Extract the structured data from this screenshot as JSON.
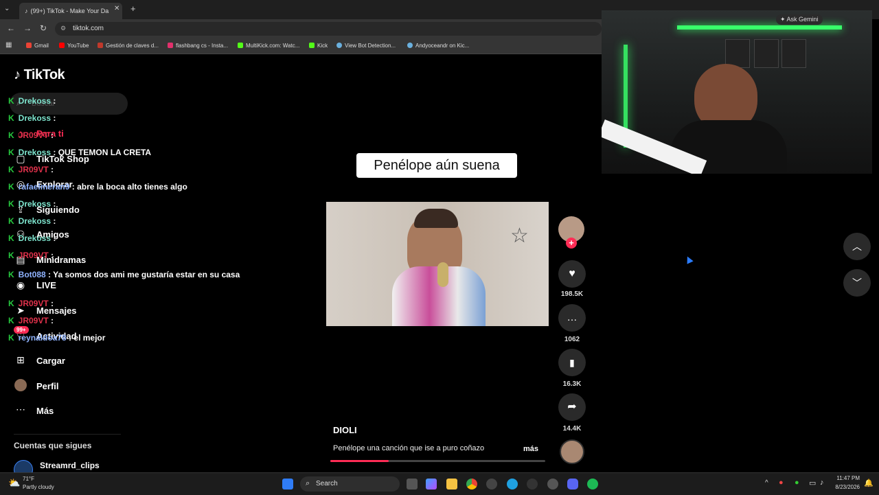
{
  "browser": {
    "tab_title": "(99+) TikTok - Make Your Da",
    "url": "tiktok.com",
    "ask_gemini": "Ask Gemini",
    "bookmarks": [
      "Gmail",
      "YouTube",
      "Gestión de claves d...",
      "flashbang cs - Insta...",
      "MultiKick.com: Watc...",
      "Kick",
      "View Bot Detection...",
      "Andyoceandr on Kic..."
    ]
  },
  "sidebar": {
    "logo": "TikTok",
    "search_placeholder": "Buscar",
    "items": [
      "Para ti",
      "TikTok Shop",
      "Explorar",
      "Siguiendo",
      "Amigos",
      "Minidramas",
      "LIVE",
      "Mensajes",
      "Actividad",
      "Cargar",
      "Perfil",
      "Más"
    ],
    "activity_badge": "99+",
    "following_heading": "Cuentas que sigues",
    "following": [
      "Streamrd_clips"
    ]
  },
  "chat": [
    {
      "user": "Drekoss",
      "msg": ""
    },
    {
      "user": "Drekoss",
      "msg": ""
    },
    {
      "user": "JR09VT",
      "msg": ""
    },
    {
      "user": "Drekoss",
      "msg": "QUE TEMON LA CRETA"
    },
    {
      "user": "JR09VT",
      "msg": ""
    },
    {
      "user": "rafaelmeran9",
      "msg": "abre la boca alto tienes algo"
    },
    {
      "user": "Drekoss",
      "msg": ""
    },
    {
      "user": "Drekoss",
      "msg": ""
    },
    {
      "user": "Drekoss",
      "msg": ""
    },
    {
      "user": "JR09VT",
      "msg": ""
    },
    {
      "user": "Bot088",
      "msg": "Ya somos dos ami me gustaría estar en su casa"
    },
    {
      "user": "JR09VT",
      "msg": ""
    },
    {
      "user": "JR09VT",
      "msg": ""
    },
    {
      "user": "reynaldoa78",
      "msg": "el mejor"
    }
  ],
  "video": {
    "caption": "Penélope aún suena",
    "author": "DIOLI",
    "description": "Penélope una canción que ise a puro coñazo",
    "more": "más",
    "likes": "198.5K",
    "comments": "1062",
    "saves": "16.3K",
    "shares": "14.4K",
    "progress": 0.27
  },
  "taskbar": {
    "weather_temp": "71°F",
    "weather_desc": "Partly cloudy",
    "search": "Search",
    "time": "11:47 PM",
    "date": "8/23/2026"
  }
}
